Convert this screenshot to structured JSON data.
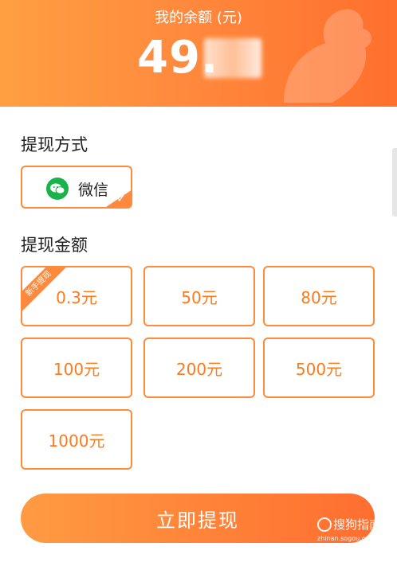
{
  "header": {
    "balance_label": "我的余额 (元)",
    "balance_value": "49."
  },
  "method_section": {
    "title": "提现方式",
    "selected_method": "微信"
  },
  "amount_section": {
    "title": "提现金额",
    "new_user_badge": "新手提现",
    "options": [
      "0.3元",
      "50元",
      "80元",
      "100元",
      "200元",
      "500元",
      "1000元"
    ]
  },
  "withdraw_button": "立即提现",
  "watermark": {
    "text": "搜狗指南",
    "url": "zhinan.sogou.com"
  },
  "colors": {
    "accent": "#ff8a3d",
    "amount_text": "#ff7a1a",
    "wechat_green": "#19b24b"
  }
}
